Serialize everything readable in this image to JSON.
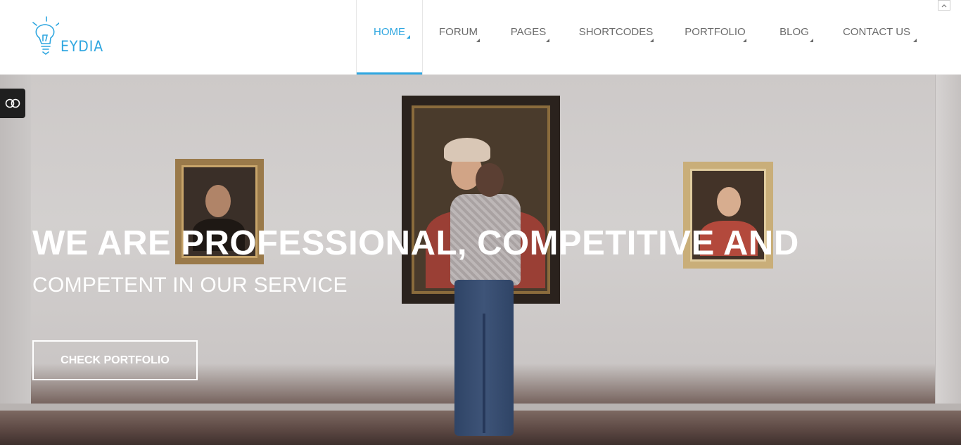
{
  "header": {
    "logo_text": "EYDIA",
    "nav": [
      {
        "label": "HOME",
        "active": true
      },
      {
        "label": "FORUM",
        "active": false
      },
      {
        "label": "PAGES",
        "active": false
      },
      {
        "label": "SHORTCODES",
        "active": false
      },
      {
        "label": "PORTFOLIO",
        "active": false
      },
      {
        "label": "BLOG",
        "active": false
      },
      {
        "label": "CONTACT US",
        "active": false
      }
    ],
    "scroll_top_icon": "chevron-up-icon"
  },
  "hero": {
    "title": "WE ARE PROFESSIONAL, COMPETITIVE AND",
    "subtitle": "COMPETENT IN OUR SERVICE",
    "cta_label": "CHECK PORTFOLIO",
    "side_toggle_icon": "toggle-icon"
  },
  "colors": {
    "accent": "#2ea6e0",
    "nav_text": "#6b6b6b",
    "toggle_bg": "#1f1f1f"
  }
}
